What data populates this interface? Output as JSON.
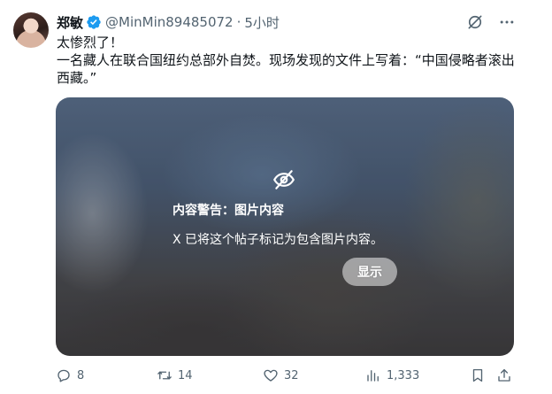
{
  "author": {
    "display_name": "郑敏",
    "handle": "@MinMin89485072",
    "separator": "·",
    "timestamp": "5小时"
  },
  "tweet": {
    "line1": "太惨烈了！",
    "line2": "一名藏人在联合国纽约总部外自焚。现场发现的文件上写着：“中国侵略者滚出西藏。”"
  },
  "media": {
    "warning_title": "内容警告：图片内容",
    "warning_desc": "X 已将这个帖子标记为包含图片内容。",
    "show_label": "显示"
  },
  "actions": {
    "replies": "8",
    "retweets": "14",
    "likes": "32",
    "views": "1,333"
  },
  "icons": {
    "verified": "verified-badge-icon",
    "grok": "grok-icon",
    "more": "more-icon",
    "hidden": "eye-slash-icon",
    "reply": "reply-icon",
    "retweet": "retweet-icon",
    "like": "heart-icon",
    "views": "views-icon",
    "bookmark": "bookmark-icon",
    "share": "share-icon"
  },
  "colors": {
    "text": "#0f1419",
    "secondary": "#536471",
    "verified_blue": "#1d9bf0"
  }
}
